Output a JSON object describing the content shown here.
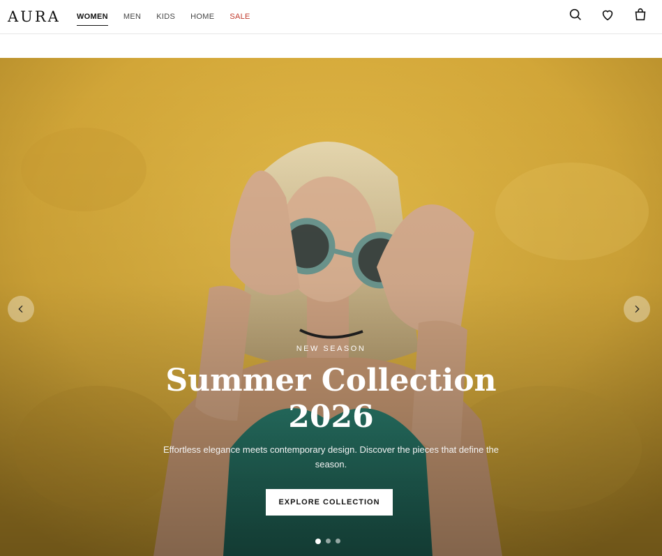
{
  "brand": {
    "logo": "AURA"
  },
  "nav": {
    "items": [
      {
        "label": "WOMEN",
        "active": true
      },
      {
        "label": "MEN"
      },
      {
        "label": "KIDS"
      },
      {
        "label": "HOME"
      },
      {
        "label": "SALE",
        "highlight": "#c0392b"
      }
    ]
  },
  "header_icons": [
    "search-icon",
    "heart-icon",
    "bag-icon"
  ],
  "hero": {
    "eyebrow": "NEW SEASON",
    "title_line1": "Summer Collection",
    "title_line2": "2026",
    "subtitle": "Effortless elegance meets contemporary design. Discover the pieces that define the season.",
    "cta": "EXPLORE COLLECTION",
    "slides": 3,
    "active_slide": 1
  },
  "colors": {
    "accent_sale": "#c0392b",
    "hero_bg": "#d8ad3a"
  }
}
